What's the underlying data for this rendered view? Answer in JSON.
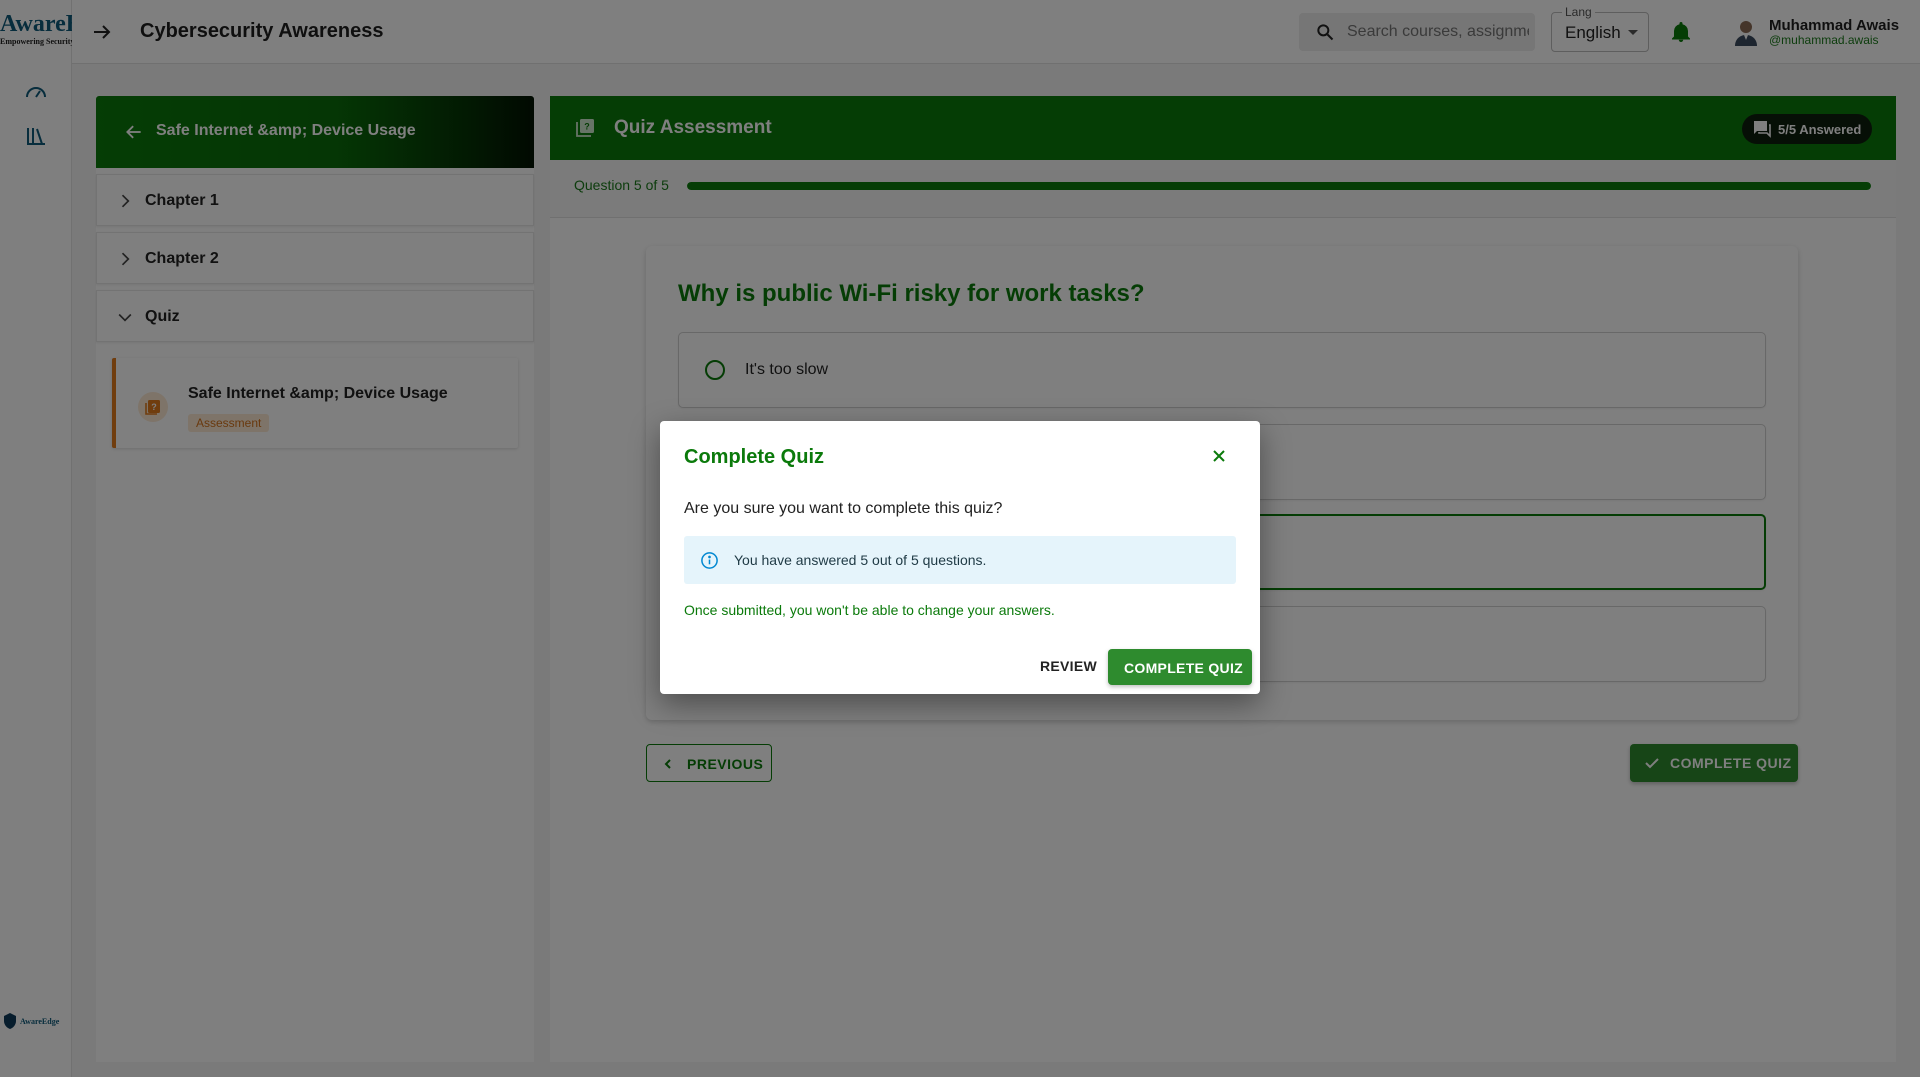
{
  "brand": {
    "logo_text": "AwareEdge",
    "tagline": "Empowering Security",
    "footer_logo_text": "AwareEdge"
  },
  "colors": {
    "primary": "#0b7a0b",
    "accent": "#2e8b2e",
    "lesson_accent": "#e07a1c",
    "info_bg": "#e5f4fb"
  },
  "rail": {
    "icons": [
      "speedometer-icon",
      "library-icon"
    ]
  },
  "topbar": {
    "back_icon": "arrow-right-icon",
    "title": "Cybersecurity Awareness",
    "search": {
      "placeholder": "Search courses, assignments..."
    },
    "language": {
      "label": "Lang",
      "value": "English"
    },
    "notification_icon": "bell-icon",
    "user": {
      "name": "Muhammad Awais",
      "handle": "@muhammad.awais"
    }
  },
  "course": {
    "title": "Safe Internet &amp; Device Usage",
    "sections": [
      {
        "label": "Chapter 1",
        "expanded": false
      },
      {
        "label": "Chapter 2",
        "expanded": false
      },
      {
        "label": "Quiz",
        "expanded": true
      }
    ],
    "active_lesson": {
      "title": "Safe Internet &amp; Device Usage",
      "badge": "Assessment"
    }
  },
  "quiz": {
    "title": "Quiz Assessment",
    "answered_chip": "5/5 Answered",
    "progress_text": "Question 5 of 5",
    "progress_fraction": 1.0,
    "question": "Why is public Wi-Fi risky for work tasks?",
    "options": [
      {
        "label": "It's too slow",
        "selected": false
      },
      {
        "label": "",
        "selected": false
      },
      {
        "label": "",
        "selected": true
      },
      {
        "label": "",
        "selected": false
      }
    ],
    "previous_label": "PREVIOUS",
    "complete_label": "COMPLETE QUIZ"
  },
  "dialog": {
    "title": "Complete Quiz",
    "question": "Are you sure you want to complete this quiz?",
    "info": "You have answered 5 out of 5 questions.",
    "warning": "Once submitted, you won't be able to change your answers.",
    "review_label": "REVIEW",
    "confirm_label": "COMPLETE QUIZ"
  }
}
